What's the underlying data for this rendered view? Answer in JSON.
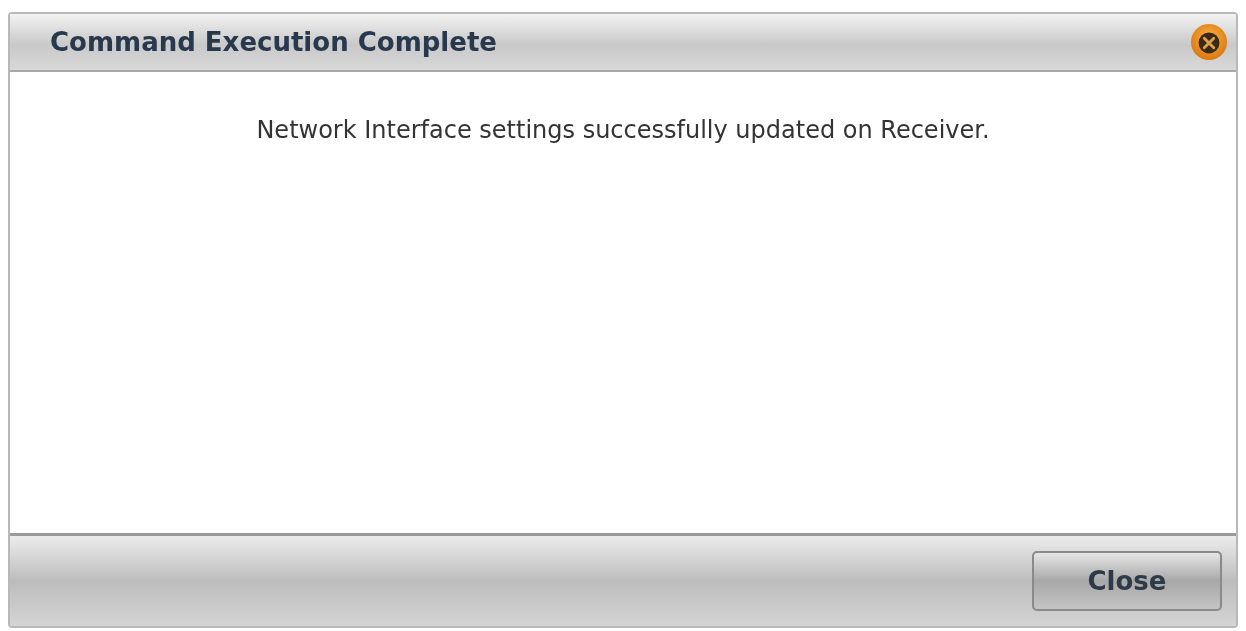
{
  "dialog": {
    "title": "Command Execution Complete",
    "message": "Network Interface settings successfully updated on Receiver.",
    "buttons": [
      "Close"
    ]
  }
}
